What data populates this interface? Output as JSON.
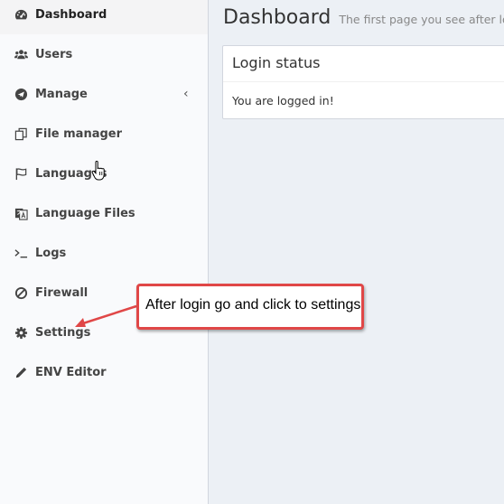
{
  "sidebar": {
    "items": [
      {
        "label": "Dashboard",
        "icon": "dashboard-icon"
      },
      {
        "label": "Users",
        "icon": "users-icon"
      },
      {
        "label": "Manage",
        "icon": "paper-plane-icon",
        "chevron": "‹"
      },
      {
        "label": "File manager",
        "icon": "copy-icon"
      },
      {
        "label": "Languages",
        "icon": "flag-icon"
      },
      {
        "label": "Language Files",
        "icon": "language-icon"
      },
      {
        "label": "Logs",
        "icon": "terminal-icon"
      },
      {
        "label": "Firewall",
        "icon": "ban-icon"
      },
      {
        "label": "Settings",
        "icon": "gear-icon"
      },
      {
        "label": "ENV Editor",
        "icon": "pencil-icon"
      }
    ]
  },
  "header": {
    "title": "Dashboard",
    "subtitle": "The first page you see after login"
  },
  "status_box": {
    "title": "Login status",
    "message": "You are logged in!"
  },
  "annotation": {
    "text": "After login go and click to settings",
    "color": "#e04747"
  }
}
